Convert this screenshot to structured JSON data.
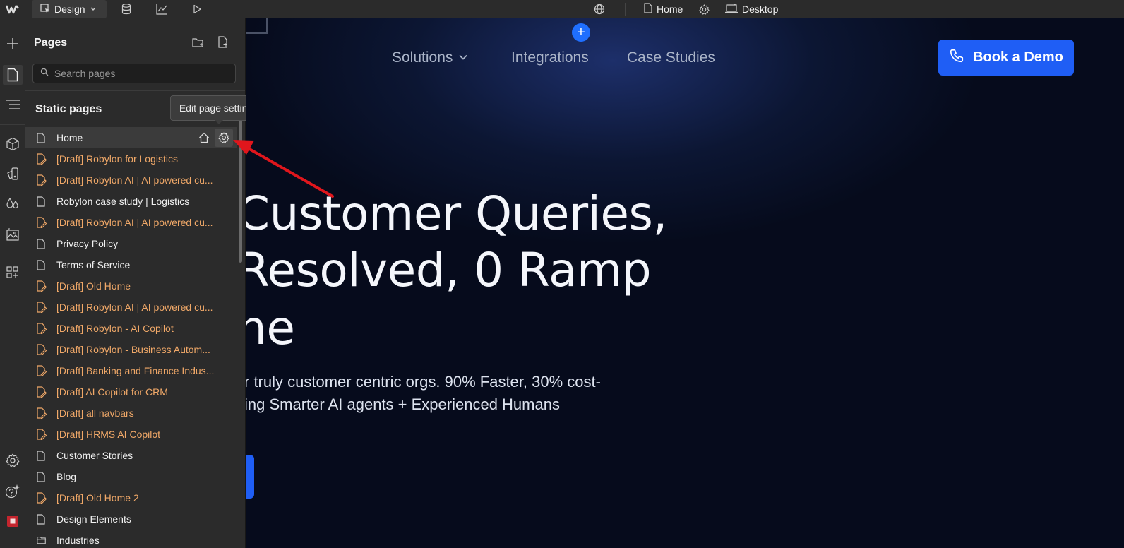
{
  "toolbar": {
    "mode_label": "Design",
    "page_label": "Home",
    "breakpoint_label": "Desktop",
    "icons": [
      "webflow-logo-icon",
      "cursor-icon",
      "chevron-down-icon",
      "database-icon",
      "analytics-icon",
      "play-icon",
      "globe-icon",
      "page-icon",
      "gear-icon",
      "desktop-icon"
    ]
  },
  "leftbar": {
    "icons": [
      "add-icon",
      "pages-icon",
      "navigator-icon",
      "components-icon",
      "styles-icon",
      "variables-icon",
      "assets-icon",
      "apps-icon",
      "settings-icon",
      "help-icon",
      "record-icon"
    ]
  },
  "pages_panel": {
    "title": "Pages",
    "search_placeholder": "Search pages",
    "section_title": "Static pages",
    "tooltip": "Edit page settings",
    "pages": [
      {
        "label": "Home",
        "draft": false,
        "selected": true
      },
      {
        "label": "[Draft] Robylon for Logistics",
        "draft": true
      },
      {
        "label": "[Draft] Robylon AI | AI powered cu...",
        "draft": true
      },
      {
        "label": "Robylon case study | Logistics",
        "draft": false
      },
      {
        "label": "[Draft] Robylon AI | AI powered cu...",
        "draft": true
      },
      {
        "label": "Privacy Policy",
        "draft": false
      },
      {
        "label": "Terms of Service",
        "draft": false
      },
      {
        "label": "[Draft] Old Home",
        "draft": true
      },
      {
        "label": "[Draft] Robylon AI | AI powered cu...",
        "draft": true
      },
      {
        "label": "[Draft] Robylon - AI Copilot",
        "draft": true
      },
      {
        "label": "[Draft] Robylon - Business Autom...",
        "draft": true
      },
      {
        "label": "[Draft] Banking and Finance Indus...",
        "draft": true
      },
      {
        "label": "[Draft] AI Copilot for CRM",
        "draft": true
      },
      {
        "label": "[Draft] all navbars",
        "draft": true
      },
      {
        "label": "[Draft] HRMS AI Copilot",
        "draft": true
      },
      {
        "label": "Customer Stories",
        "draft": false
      },
      {
        "label": "Blog",
        "draft": false
      },
      {
        "label": "[Draft] Old Home 2",
        "draft": true
      },
      {
        "label": "Design Elements",
        "draft": false
      },
      {
        "label": "Industries",
        "draft": false,
        "folder": true
      }
    ]
  },
  "canvas": {
    "nav": {
      "solutions": "Solutions",
      "integrations": "Integrations",
      "case_studies": "Case Studies",
      "cta": "Book a Demo"
    },
    "hero_line1": "Customer Queries,",
    "hero_line2": "Resolved, 0 Ramp",
    "hero_line3": "ne",
    "sub_line1": "r truly customer centric orgs. 90% Faster, 30% cost-",
    "sub_line2": "ing Smarter AI agents + Experienced Humans"
  },
  "colors": {
    "accent": "#1f5ef5",
    "draft": "#f0a868",
    "annotation_arrow": "#e0161c"
  }
}
